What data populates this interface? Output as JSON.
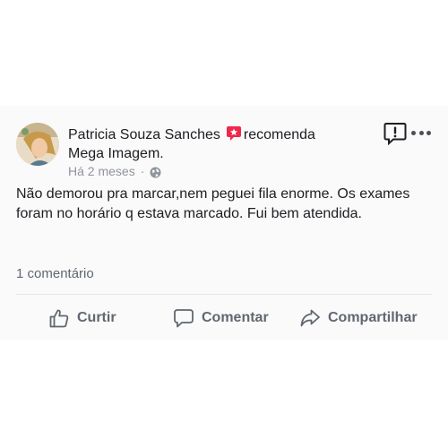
{
  "post": {
    "author": "Patricia Souza Sanches",
    "recommend_verb": "recomenda",
    "page_name": "Mega Imagem.",
    "time": "Há 2 meses",
    "separator": "·",
    "text": "Não demorou pra marcar,nem peguei fila enorme. Os exames foram no horário q estava marcado. Fui bem atendida.",
    "comments_count": "1 comentário"
  },
  "actions": {
    "like": "Curtir",
    "comment": "Comentar",
    "share": "Compartilhar"
  },
  "icons": {
    "recommend": "recommend-star-icon",
    "privacy": "globe-icon",
    "report": "report-exclamation-icon",
    "more": "more-options-icon",
    "like": "thumbs-up-icon",
    "comment": "comment-bubble-icon",
    "share": "share-arrow-icon"
  },
  "colors": {
    "recommend_red": "#f0284a",
    "action_gray": "#606770",
    "meta_gray": "#90949c"
  }
}
